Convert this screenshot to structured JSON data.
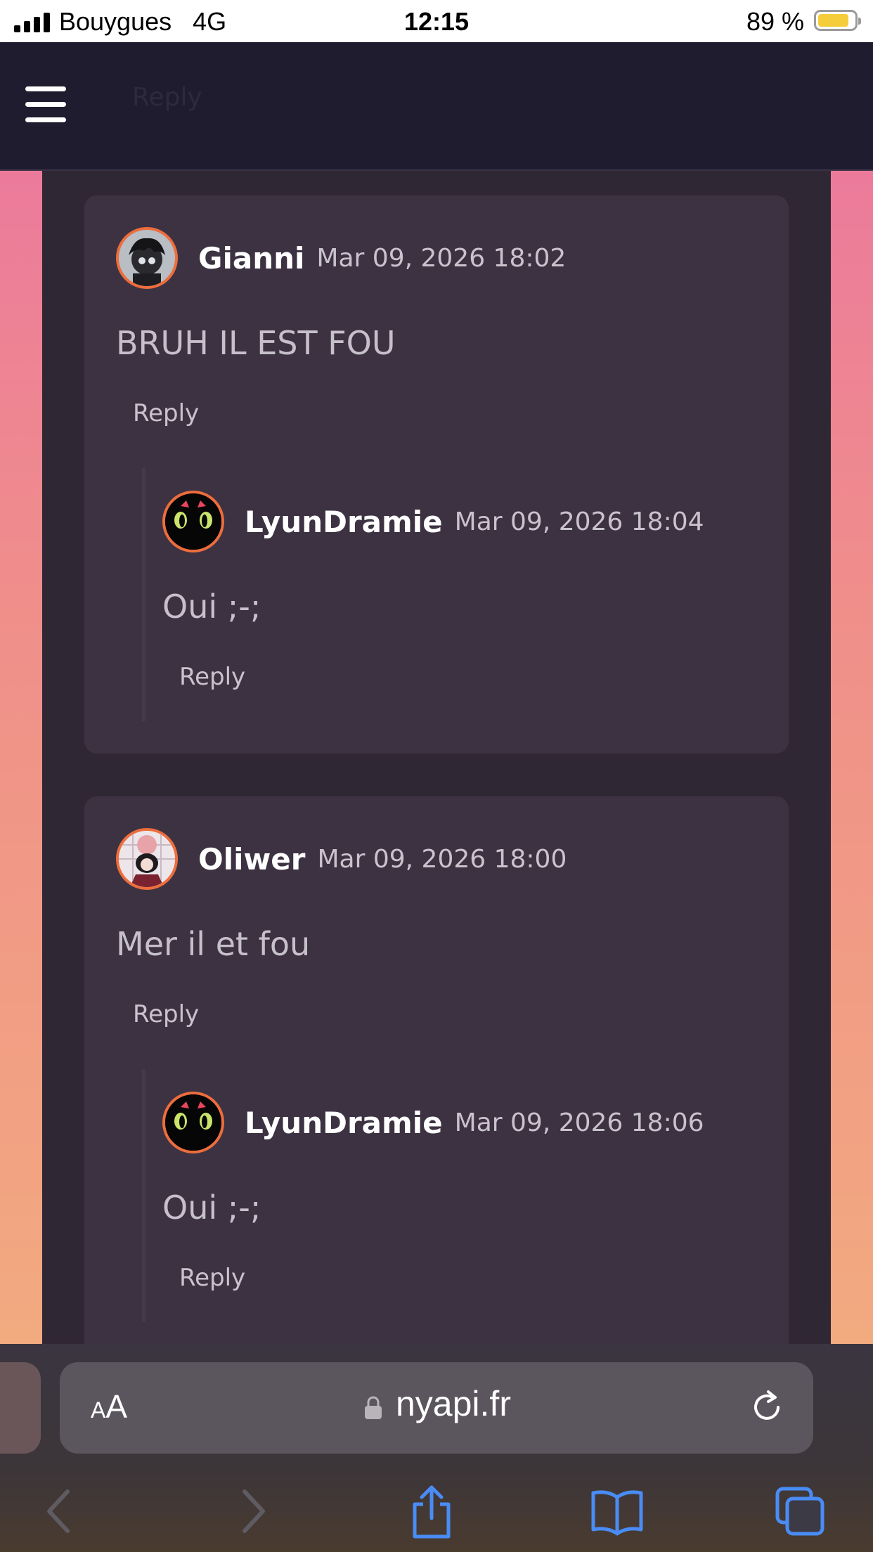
{
  "status_bar": {
    "carrier": "Bouygues",
    "network": "4G",
    "time": "12:15",
    "battery_percent": "89 %",
    "battery_level": 0.89,
    "battery_color": "#f5cd3a"
  },
  "header": {
    "menu_icon": "hamburger-icon",
    "partial_reply": "Reply"
  },
  "comments": [
    {
      "author": "Gianni",
      "date": "Mar 09, 2026 18:02",
      "text": "BRUH IL EST FOU",
      "reply_label": "Reply",
      "replies": [
        {
          "author": "LyunDramie",
          "date": "Mar 09, 2026 18:04",
          "text": "Oui ;-;",
          "reply_label": "Reply"
        }
      ]
    },
    {
      "author": "Oliwer",
      "date": "Mar 09, 2026 18:00",
      "text": "Mer il et fou",
      "reply_label": "Reply",
      "replies": [
        {
          "author": "LyunDramie",
          "date": "Mar 09, 2026 18:06",
          "text": "Oui ;-;",
          "reply_label": "Reply"
        }
      ]
    }
  ],
  "browser": {
    "text_size_label_small": "A",
    "text_size_label_big": "A",
    "url": "nyapi.fr",
    "icons": [
      "lock-icon",
      "reload-icon",
      "back-icon",
      "forward-icon",
      "share-icon",
      "bookmarks-icon",
      "tabs-icon"
    ]
  },
  "colors": {
    "accent": "#ee6d3c",
    "card": "#3d3242",
    "panel": "#302735",
    "toolbar_icon": "#4a8cf5"
  }
}
